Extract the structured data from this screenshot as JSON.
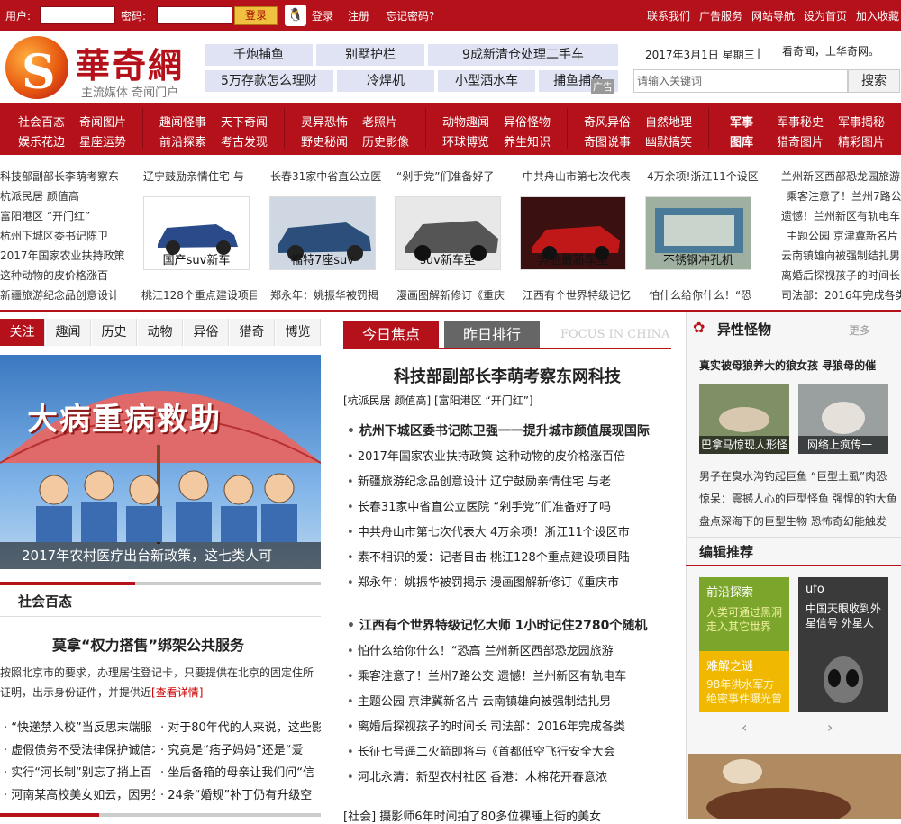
{
  "topbar": {
    "user_label": "用户:",
    "pass_label": "密码:",
    "login_btn": "登录",
    "qq_login": "登录",
    "register": "注册",
    "forgot": "忘记密码?",
    "links": [
      "联系我们",
      "广告服务",
      "网站导航",
      "设为首页",
      "加入收藏"
    ]
  },
  "header": {
    "logo": "華奇網",
    "logo_sub": "主流媒体 奇闻门户",
    "ads": [
      "千炮捕鱼",
      "别墅护栏",
      "9成新清仓处理二手车",
      "5万存款怎么理财",
      "冷焊机",
      "小型洒水车",
      "捕鱼捕鱼"
    ],
    "ad_tag": "广告",
    "date": "2017年3月1日 星期三",
    "slogan": "看奇闻，上华奇网。",
    "search_placeholder": "请输入关键词",
    "search_btn": "搜索"
  },
  "nav": {
    "col1": [
      "社会百态",
      "奇闻图片",
      "娱乐花边",
      "星座运势"
    ],
    "col2": [
      "趣闻怪事",
      "天下奇闻",
      "前沿探索",
      "考古发现"
    ],
    "col3": [
      "灵异恐怖",
      "老照片",
      "野史秘闻",
      "历史影像"
    ],
    "col4": [
      "动物趣闻",
      "异俗怪物",
      "环球博览",
      "养生知识"
    ],
    "col5": [
      "奇风异俗",
      "自然地理",
      "奇图说事",
      "幽默搞笑"
    ],
    "col6_head": [
      "军事",
      "图库"
    ],
    "col6": [
      "军事秘史",
      "军事揭秘",
      "猎奇图片",
      "精彩图片"
    ]
  },
  "strip": {
    "left": [
      "科技部副部长李萌考察东",
      "杭派民居 颜值高",
      "富阳港区 “开门红”",
      "杭州下城区委书记陈卫",
      "2017年国家农业扶持政策",
      "这种动物的皮价格涨百",
      "新疆旅游纪念品创意设计"
    ],
    "tops": [
      "辽宁鼓励亲情住宅 与",
      "长春31家中省直公立医",
      "“剁手党”们准备好了",
      "中共舟山市第七次代表",
      "4万余项!浙江11个设区"
    ],
    "captions": [
      "国产suv新车",
      "福特7座suv",
      "suv新车型",
      "奔驰最新车型",
      "不锈钢冲孔机"
    ],
    "bottoms": [
      "桃江128个重点建设项目",
      "郑永年：姚振华被罚揭",
      "漫画图解新修订《重庆",
      "江西有个世界特级记忆",
      "怕什么给你什么！“恐"
    ],
    "right": [
      "兰州新区西部恐龙园旅游",
      "乘客注意了！兰州7路公",
      "遗憾！兰州新区有轨电车",
      "主题公园 京津冀新名片",
      "云南镇雄向被强制结扎男",
      "离婚后探视孩子的时间长",
      "司法部：2016年完成各类"
    ]
  },
  "left": {
    "tabs": [
      "关注",
      "趣闻",
      "历史",
      "动物",
      "异俗",
      "猎奇",
      "博览"
    ],
    "banner_text": "大病重病救助",
    "banner_caption": "2017年农村医疗出台新政策，这七类人可",
    "section": "社会百态",
    "headline": "莫拿“权力搭售”绑架公共服务",
    "summary": "按照北京市的要求，办理居住登记卡，只要提供在北京的固定住所证明，出示身份证件，并提供近",
    "more": "[查看详情]",
    "list": [
      "“快递禁入校”当反思末端服",
      "对于80年代的人来说，这些影",
      "虚假债务不受法律保护诚信才",
      "究竟是“痞子妈妈”还是“爱",
      "实行“河长制”别忘了捎上百",
      "坐后备箱的母亲让我们问“信",
      "河南某高校美女如云，因男生",
      "24条“婚规”补丁仍有升级空"
    ]
  },
  "center": {
    "tab1": "今日焦点",
    "tab2": "昨日排行",
    "watermark": "FOCUS IN CHINA",
    "headline": "科技部副部长李萌考察东网科技",
    "subline": "[杭派民居 颜值高] [富阳港区 “开门红”]",
    "group1_bold": "杭州下城区委书记陈卫强一一提升城市颜值展现国际",
    "group1": [
      "2017年国家农业扶持政策 这种动物的皮价格涨百倍",
      "新疆旅游纪念品创意设计 辽宁鼓励亲情住宅 与老",
      "长春31家中省直公立医院 “剁手党”们准备好了吗",
      "中共舟山市第七次代表大 4万余项！浙江11个设区市",
      "素不相识的爱：记者目击 桃江128个重点建设项目陆",
      "郑永年：姚振华被罚揭示 漫画图解新修订《重庆市"
    ],
    "group2_bold": "江西有个世界特级记忆大师 1小时记住2780个随机",
    "group2": [
      "怕什么给你什么！“恐高 兰州新区西部恐龙园旅游",
      "乘客注意了！兰州7路公交 遗憾！兰州新区有轨电车",
      "主题公园 京津冀新名片 云南镇雄向被强制结扎男",
      "离婚后探视孩子的时间长 司法部：2016年完成各类",
      "长征七号遥二火箭即将与《首都低空飞行安全大会",
      "河北永清：新型农村社区 香港：木棉花开春意浓"
    ],
    "bottom": "[社会] 摄影师6年时间拍了80多位裸睡上街的美女"
  },
  "right": {
    "title": "异性怪物",
    "more": "更多",
    "bold": "真实被母狼养大的狼女孩 寻狼母的催",
    "captions": [
      "巴拿马惊现人形怪",
      "网络上疯传一"
    ],
    "text": [
      "男子在臭水沟钓起巨鱼 “巨型土虱”肉恐",
      "惊呆：震撼人心的巨型怪鱼 强悍的钓大鱼",
      "盘点深海下的巨型生物 恐怖奇幻能触发"
    ],
    "editor": "编辑推荐",
    "box1_title": "前沿探索",
    "box1_text": "人类可通过黑洞走入其它世界",
    "box2_title": "ufo",
    "box2_text": "中国天眼收到外星信号 外星人",
    "box3_title": "难解之谜",
    "box3_text": "98年洪水军方绝密事件曝光曾",
    "colors": {
      "green": "#7ba62b",
      "yellow": "#f0b800",
      "dark": "#3a3a3a"
    }
  },
  "colors": {
    "brand": "#b5111a",
    "ad_bg": "#dfe3f3"
  }
}
